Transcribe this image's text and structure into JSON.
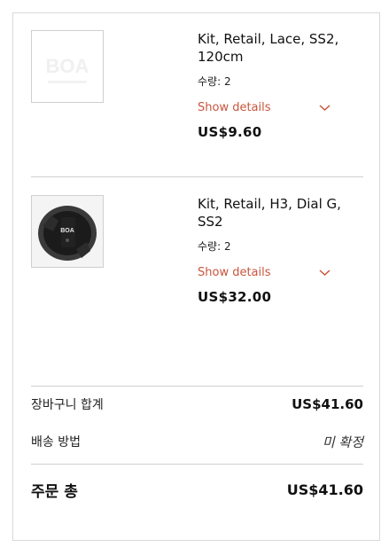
{
  "items": [
    {
      "thumbnail": "boa-logo-placeholder",
      "thumb_text": "BOA",
      "name": "Kit, Retail, Lace, SS2, 120cm",
      "quantity": "수량: 2",
      "details_label": "Show details",
      "price": "US$9.60"
    },
    {
      "thumbnail": "boa-h3-dial-image",
      "thumb_text": "BOA",
      "name": "Kit, Retail, H3, Dial G, SS2",
      "quantity": "수량: 2",
      "details_label": "Show details",
      "price": "US$32.00"
    }
  ],
  "summary": {
    "subtotal_label": "장바구니 합계",
    "subtotal_value": "US$41.60",
    "shipping_label": "배송 방법",
    "shipping_value": "미 확정",
    "total_label": "주문 총",
    "total_value": "US$41.60"
  },
  "colors": {
    "accent": "#c8553d",
    "border": "#d9d9d9",
    "text": "#111111"
  }
}
